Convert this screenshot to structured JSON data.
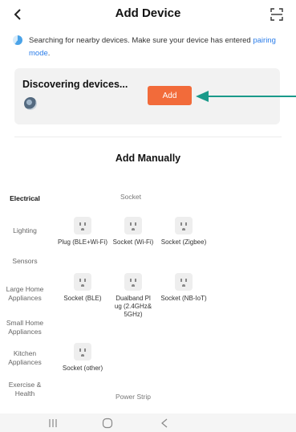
{
  "header": {
    "title": "Add Device"
  },
  "notice": {
    "text_before_link": "Searching for nearby devices. Make sure your device has entered ",
    "link": "pairing mode",
    "text_after_link": "."
  },
  "discover": {
    "title": "Discovering devices...",
    "add_label": "Add"
  },
  "manual": {
    "title": "Add Manually"
  },
  "sidebar": {
    "items": [
      {
        "label": "Electrical",
        "active": true
      },
      {
        "label": "Lighting"
      },
      {
        "label": "Sensors"
      },
      {
        "label": "Large Home Appliances"
      },
      {
        "label": "Small Home Appliances"
      },
      {
        "label": "Kitchen Appliances"
      },
      {
        "label": "Exercise & Health"
      }
    ]
  },
  "category": {
    "header": "Socket",
    "tiles": [
      {
        "label": "Plug (BLE+Wi-Fi)"
      },
      {
        "label": "Socket (Wi-Fi)"
      },
      {
        "label": "Socket (Zigbee)"
      },
      {
        "label": "Socket (BLE)"
      },
      {
        "label": "Dualband Plug (2.4GHz&5GHz)"
      },
      {
        "label": "Socket (NB-IoT)"
      },
      {
        "label": "Socket (other)"
      }
    ],
    "next_header": "Power Strip"
  },
  "colors": {
    "accent": "#f26b3a",
    "link": "#2b7de9",
    "arrow": "#1a9a8a"
  },
  "icons": [
    "back-arrow-icon",
    "scan-icon",
    "loading-icon",
    "device-icon",
    "socket-icon",
    "recent-apps-icon",
    "home-icon",
    "back-nav-icon"
  ]
}
